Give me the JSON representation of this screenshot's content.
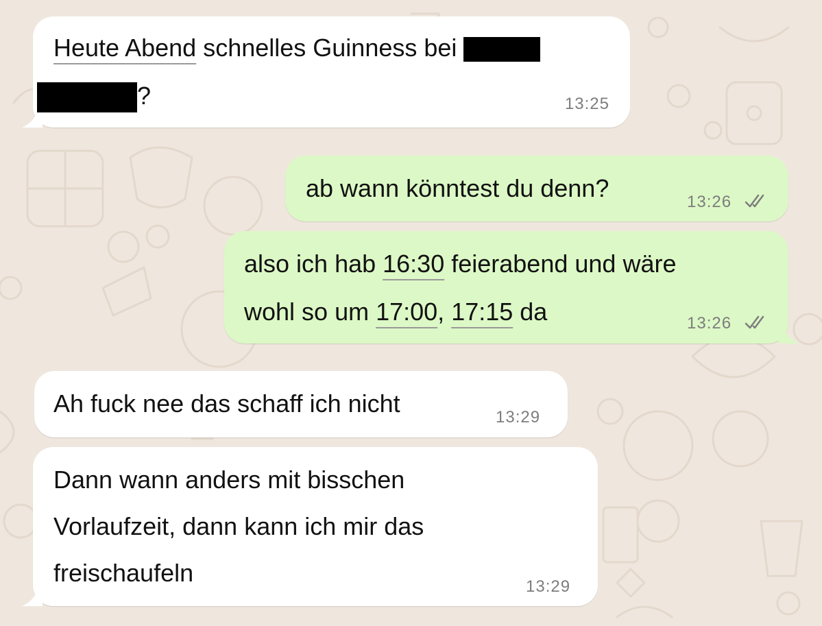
{
  "messages": [
    {
      "direction": "incoming",
      "text_before_redaction": "Heute Abend",
      "text_rest": " schnelles Guinness bei ",
      "text_end": "?",
      "time": "13:25"
    },
    {
      "direction": "outgoing",
      "text": "ab wann könntest du denn?",
      "time": "13:26",
      "status": "read"
    },
    {
      "direction": "outgoing",
      "line1_before": "also ich hab ",
      "line1_link": "16:30",
      "line1_after": " feierabend und wäre",
      "line2_before": "wohl so um ",
      "line2_link1": "17:00",
      "line2_sep": ", ",
      "line2_link2": "17:15",
      "line2_after": " da",
      "time": "13:26",
      "status": "read"
    },
    {
      "direction": "incoming",
      "text": "Ah fuck nee das schaff ich nicht",
      "time": "13:29"
    },
    {
      "direction": "incoming",
      "lines": [
        "Dann wann anders mit bisschen",
        "Vorlaufzeit, dann kann ich mir das",
        "freischaufeln"
      ],
      "time": "13:29"
    }
  ],
  "colors": {
    "background": "#efe7de",
    "incoming_bubble": "#ffffff",
    "outgoing_bubble": "#dcf8c6",
    "timestamp": "#7d7d7d",
    "read_ticks": "#7d7d7d"
  },
  "icons": {
    "read_receipt": "double-check-icon",
    "background_pattern": "doodle-pattern"
  }
}
